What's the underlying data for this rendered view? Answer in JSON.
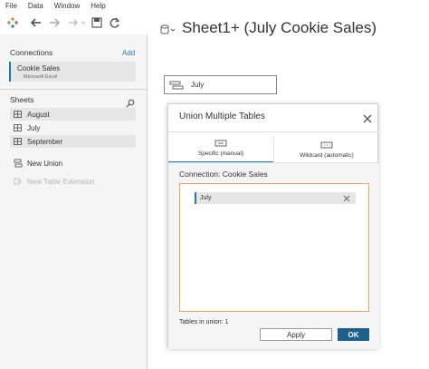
{
  "menu": {
    "items": [
      "File",
      "Data",
      "Window",
      "Help"
    ]
  },
  "toolbar": {
    "icons": [
      "tableau-logo-icon",
      "back-icon",
      "forward-icon",
      "pause-icon",
      "save-icon",
      "refresh-icon"
    ]
  },
  "connections": {
    "title": "Connections",
    "add_label": "Add",
    "items": [
      {
        "name": "Cookie Sales",
        "type": "Microsoft Excel"
      }
    ]
  },
  "sheets": {
    "title": "Sheets",
    "items": [
      {
        "label": "August",
        "highlighted": true
      },
      {
        "label": "July",
        "highlighted": false
      },
      {
        "label": "September",
        "highlighted": true
      }
    ]
  },
  "actions": {
    "new_union": "New Union",
    "new_table_extension": "New Table Extension"
  },
  "main": {
    "title": "Sheet1+ (July Cookie Sales)",
    "union_pill_label": "July"
  },
  "dialog": {
    "title": "Union Multiple Tables",
    "tabs": [
      {
        "label": "Specific (manual)",
        "active": true
      },
      {
        "label": "Wildcard (automatic)",
        "active": false
      }
    ],
    "connection_label": "Connection: Cookie Sales",
    "tables": [
      "July"
    ],
    "tables_in_union": "Tables in union: 1",
    "apply_label": "Apply",
    "ok_label": "OK"
  },
  "colors": {
    "accent": "#1f77b4",
    "ok_button": "#1f5f8b",
    "drop_border": "#f0a460",
    "panel_bg": "#f5f5f5"
  }
}
